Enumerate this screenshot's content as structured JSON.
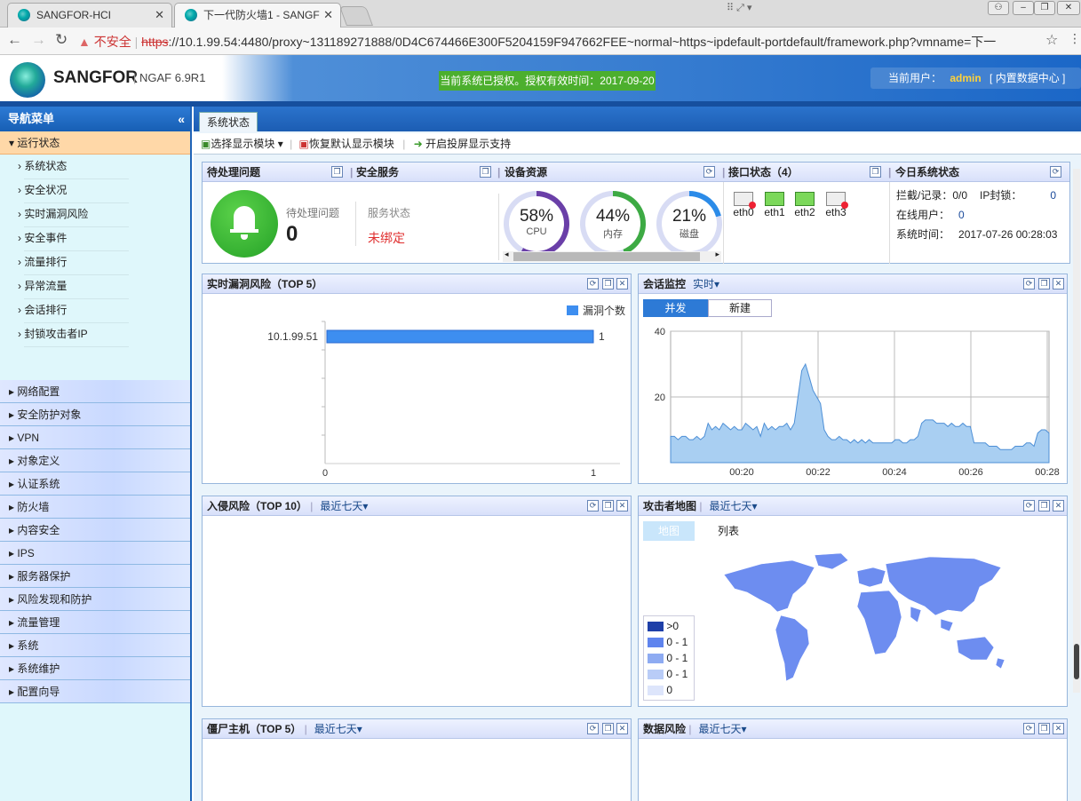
{
  "browser": {
    "tabs": [
      {
        "title": "SANGFOR-HCI"
      },
      {
        "title": "下一代防火墙1 - SANGF"
      }
    ],
    "insecure_label": "不安全",
    "url_scheme": "https",
    "url_rest": "://10.1.99.54:4480/proxy~131189271888/0D4C674466E300F5204159F947662FEE~normal~https~ipdefault-portdefault/framework.php?vmname=下一"
  },
  "header": {
    "brand": "SANGFOR",
    "product": "NGAF 6.9R1",
    "license_text": "当前系统已授权。授权有效时间：2017-09-20",
    "user_label": "当前用户：",
    "user_name": "admin",
    "datacenter_link": "[ 内置数据中心 ]"
  },
  "sidebar": {
    "title": "导航菜单",
    "open_group": "运行状态",
    "sub_items": [
      "系统状态",
      "安全状况",
      "实时漏洞风险",
      "安全事件",
      "流量排行",
      "异常流量",
      "会话排行",
      "封锁攻击者IP"
    ],
    "groups": [
      "网络配置",
      "安全防护对象",
      "VPN",
      "对象定义",
      "认证系统",
      "防火墙",
      "内容安全",
      "IPS",
      "服务器保护",
      "风险发现和防护",
      "流量管理",
      "系统",
      "系统维护",
      "配置向导"
    ]
  },
  "main": {
    "page_tab": "系统状态",
    "toolbar": {
      "select_modules": "选择显示模块",
      "restore_default": "恢复默认显示模块",
      "projection": "开启投屏显示支持"
    }
  },
  "pending": {
    "title": "待处理问题",
    "label": "待处理问题",
    "count": "0"
  },
  "service": {
    "title": "安全服务",
    "label": "服务状态",
    "status": "未绑定"
  },
  "resources": {
    "title": "设备资源",
    "items": [
      {
        "pct": "58%",
        "label": "CPU",
        "value": 58,
        "color": "#6a3fa8"
      },
      {
        "pct": "44%",
        "label": "内存",
        "value": 44,
        "color": "#3daa44"
      },
      {
        "pct": "21%",
        "label": "磁盘",
        "value": 21,
        "color": "#2b8be8"
      }
    ]
  },
  "interfaces": {
    "title": "接口状态（4）",
    "items": [
      {
        "name": "eth0",
        "up": false
      },
      {
        "name": "eth1",
        "up": true
      },
      {
        "name": "eth2",
        "up": true
      },
      {
        "name": "eth3",
        "up": false
      }
    ]
  },
  "today": {
    "title": "今日系统状态",
    "block_label": "拦截/记录：",
    "block_value": "0/0",
    "ipblock_label": "IP封锁：",
    "ipblock_value": "0",
    "online_label": "在线用户：",
    "online_value": "0",
    "time_label": "系统时间：",
    "time_value": "2017-07-26 00:28:03"
  },
  "vuln": {
    "title": "实时漏洞风险（TOP 5）"
  },
  "session": {
    "title": "会话监控",
    "dropdown": "实时",
    "tab_active": "并发",
    "tab_other": "新建"
  },
  "intrusion": {
    "title": "入侵风险（TOP 10）",
    "dropdown": "最近七天"
  },
  "attacker": {
    "title": "攻击者地图",
    "dropdown": "最近七天",
    "tab_map": "地图",
    "tab_list": "列表",
    "legend": [
      {
        "label": ">0",
        "color": "#1e3fa8"
      },
      {
        "label": "0 - 1",
        "color": "#5f84ee"
      },
      {
        "label": "0 - 1",
        "color": "#8eabf2"
      },
      {
        "label": "0 - 1",
        "color": "#b9ccf7"
      },
      {
        "label": "0",
        "color": "#dde5fb"
      }
    ]
  },
  "botnet": {
    "title": "僵尸主机（TOP 5）",
    "dropdown": "最近七天"
  },
  "datarisk": {
    "title": "数据风险",
    "dropdown": "最近七天"
  },
  "chart_data": [
    {
      "type": "bar",
      "orientation": "horizontal",
      "categories": [
        "10.1.99.51"
      ],
      "values": [
        1
      ],
      "legend": [
        "漏洞个数"
      ],
      "legend_position": "top-right",
      "xlim": [
        0,
        1
      ],
      "x_ticks": [
        "0",
        "1"
      ],
      "series": [
        {
          "name": "漏洞个数",
          "values": [
            1
          ],
          "color": "#3d8ef0"
        }
      ]
    },
    {
      "type": "area",
      "x_ticks": [
        "00:20",
        "00:22",
        "00:24",
        "00:26",
        "00:28"
      ],
      "y_ticks": [
        "20",
        "40"
      ],
      "ylim": [
        0,
        40
      ],
      "grid": true,
      "series": [
        {
          "name": "并发",
          "color": "#7fb8ea",
          "values": [
            8,
            8,
            7,
            8,
            8,
            7,
            7,
            8,
            7,
            8,
            12,
            10,
            11,
            10,
            12,
            11,
            10,
            11,
            10,
            10,
            12,
            11,
            10,
            11,
            8,
            12,
            10,
            11,
            10,
            11,
            11,
            12,
            10,
            12,
            20,
            28,
            30,
            26,
            22,
            20,
            18,
            10,
            8,
            7,
            7,
            8,
            7,
            7,
            6,
            7,
            6,
            7,
            6,
            7,
            6,
            6,
            6,
            6,
            6,
            6,
            7,
            7,
            6,
            6,
            7,
            7,
            8,
            12,
            13,
            13,
            13,
            12,
            12,
            12,
            11,
            12,
            11,
            11,
            12,
            11,
            11,
            6,
            6,
            6,
            6,
            5,
            5,
            5,
            4,
            4,
            4,
            4,
            5,
            5,
            5,
            6,
            6,
            5,
            9,
            10,
            10,
            9
          ]
        }
      ]
    }
  ]
}
